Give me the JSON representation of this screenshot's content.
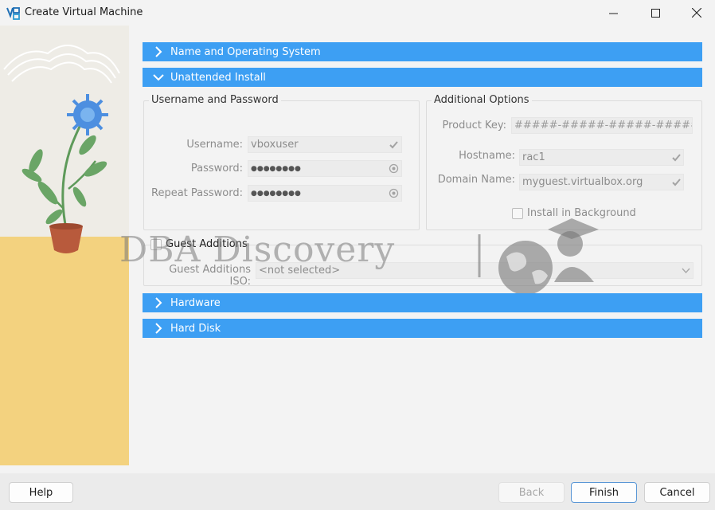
{
  "window": {
    "title": "Create Virtual Machine",
    "minimize_icon": "minimize-icon",
    "maximize_icon": "maximize-icon",
    "close_icon": "close-icon"
  },
  "sections": {
    "name_os": {
      "label": "Name and Operating System",
      "expanded": false
    },
    "unattended": {
      "label": "Unattended Install",
      "expanded": true
    },
    "hardware": {
      "label": "Hardware",
      "expanded": false
    },
    "hard_disk": {
      "label": "Hard Disk",
      "expanded": false
    }
  },
  "credentials": {
    "title": "Username and Password",
    "username_label": "Username:",
    "username_value": "vboxuser",
    "password_label": "Password:",
    "password_value": "●●●●●●●●",
    "repeat_label": "Repeat Password:",
    "repeat_value": "●●●●●●●●"
  },
  "additional": {
    "title": "Additional Options",
    "product_key_label": "Product Key:",
    "product_key_value": "#####-#####-#####-#####-#####",
    "hostname_label": "Hostname:",
    "hostname_value": "rac1",
    "domain_label": "Domain Name:",
    "domain_value": "myguest.virtualbox.org",
    "install_bg_label": "Install in Background",
    "install_bg_checked": false
  },
  "guest_additions": {
    "label": "Guest Additions",
    "checked": false,
    "iso_label": "Guest Additions ISO:",
    "iso_value": "<not selected>"
  },
  "watermark": {
    "text": "DBA Discovery"
  },
  "buttons": {
    "help": "Help",
    "back": "Back",
    "finish": "Finish",
    "cancel": "Cancel"
  },
  "colors": {
    "section_bar": "#3d9ff3",
    "window_bg": "#f3f3f3",
    "sidebar_floor": "#f3d27f"
  }
}
